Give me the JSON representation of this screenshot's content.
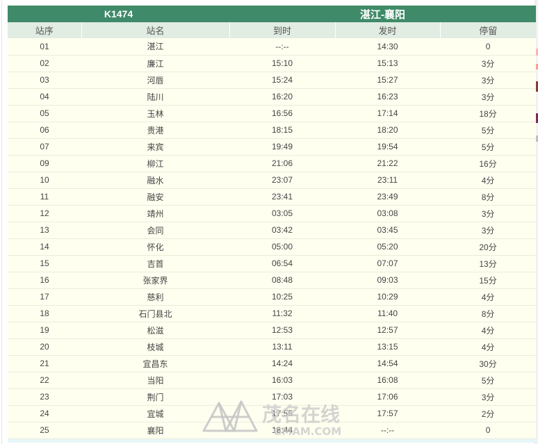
{
  "train": "K1474",
  "route": "湛江-襄阳",
  "headers": [
    "站序",
    "站名",
    "到时",
    "发时",
    "停留"
  ],
  "stops": [
    {
      "seq": "01",
      "name": "湛江",
      "arrive": "--:--",
      "depart": "14:30",
      "stay": "0"
    },
    {
      "seq": "02",
      "name": "廉江",
      "arrive": "15:10",
      "depart": "15:13",
      "stay": "3分"
    },
    {
      "seq": "03",
      "name": "河唇",
      "arrive": "15:24",
      "depart": "15:27",
      "stay": "3分"
    },
    {
      "seq": "04",
      "name": "陆川",
      "arrive": "16:20",
      "depart": "16:23",
      "stay": "3分"
    },
    {
      "seq": "05",
      "name": "玉林",
      "arrive": "16:56",
      "depart": "17:14",
      "stay": "18分"
    },
    {
      "seq": "06",
      "name": "贵港",
      "arrive": "18:15",
      "depart": "18:20",
      "stay": "5分"
    },
    {
      "seq": "07",
      "name": "来宾",
      "arrive": "19:49",
      "depart": "19:54",
      "stay": "5分"
    },
    {
      "seq": "09",
      "name": "柳江",
      "arrive": "21:06",
      "depart": "21:22",
      "stay": "16分"
    },
    {
      "seq": "10",
      "name": "融水",
      "arrive": "23:07",
      "depart": "23:11",
      "stay": "4分"
    },
    {
      "seq": "11",
      "name": "融安",
      "arrive": "23:41",
      "depart": "23:49",
      "stay": "8分"
    },
    {
      "seq": "12",
      "name": "靖州",
      "arrive": "03:05",
      "depart": "03:08",
      "stay": "3分"
    },
    {
      "seq": "13",
      "name": "会同",
      "arrive": "03:42",
      "depart": "03:45",
      "stay": "3分"
    },
    {
      "seq": "14",
      "name": "怀化",
      "arrive": "05:00",
      "depart": "05:20",
      "stay": "20分"
    },
    {
      "seq": "15",
      "name": "吉首",
      "arrive": "06:54",
      "depart": "07:07",
      "stay": "13分"
    },
    {
      "seq": "16",
      "name": "张家界",
      "arrive": "08:48",
      "depart": "09:03",
      "stay": "15分"
    },
    {
      "seq": "17",
      "name": "慈利",
      "arrive": "10:25",
      "depart": "10:29",
      "stay": "4分"
    },
    {
      "seq": "18",
      "name": "石门县北",
      "arrive": "11:32",
      "depart": "11:40",
      "stay": "8分"
    },
    {
      "seq": "19",
      "name": "松滋",
      "arrive": "12:53",
      "depart": "12:57",
      "stay": "4分"
    },
    {
      "seq": "20",
      "name": "枝城",
      "arrive": "13:11",
      "depart": "13:15",
      "stay": "4分"
    },
    {
      "seq": "21",
      "name": "宜昌东",
      "arrive": "14:24",
      "depart": "14:54",
      "stay": "30分"
    },
    {
      "seq": "22",
      "name": "当阳",
      "arrive": "16:03",
      "depart": "16:08",
      "stay": "5分"
    },
    {
      "seq": "23",
      "name": "荆门",
      "arrive": "17:03",
      "depart": "17:06",
      "stay": "3分"
    },
    {
      "seq": "24",
      "name": "宜城",
      "arrive": "17:55",
      "depart": "17:57",
      "stay": "2分"
    },
    {
      "seq": "25",
      "name": "襄阳",
      "arrive": "18:44",
      "depart": "--:--",
      "stay": "0"
    }
  ],
  "watermark": {
    "cn": "茂名在线",
    "en": "GMAM.COM"
  },
  "colors": {
    "header_green": "#3f8a68",
    "subheader": "#e1ece2",
    "row_bg": "#fffff0"
  }
}
